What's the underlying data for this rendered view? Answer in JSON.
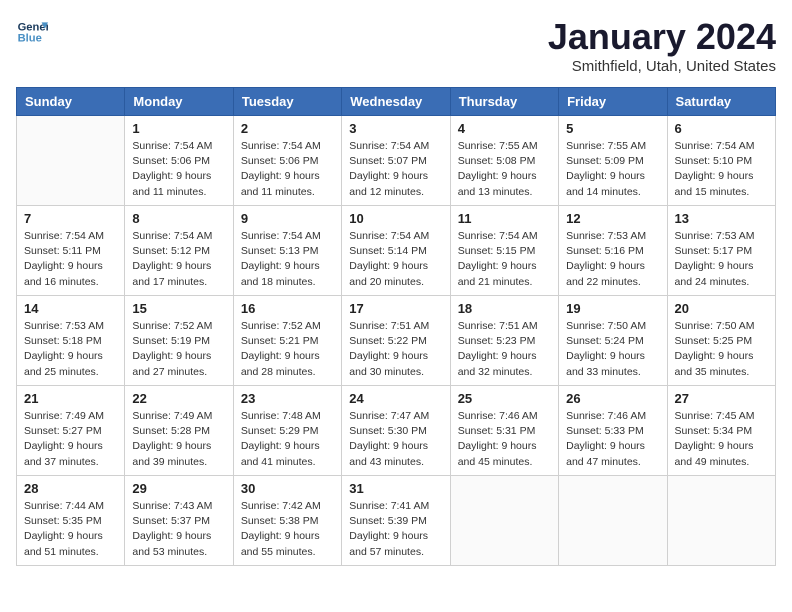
{
  "header": {
    "logo_line1": "General",
    "logo_line2": "Blue",
    "month_year": "January 2024",
    "location": "Smithfield, Utah, United States"
  },
  "weekdays": [
    "Sunday",
    "Monday",
    "Tuesday",
    "Wednesday",
    "Thursday",
    "Friday",
    "Saturday"
  ],
  "weeks": [
    [
      {
        "day": "",
        "info": ""
      },
      {
        "day": "1",
        "info": "Sunrise: 7:54 AM\nSunset: 5:06 PM\nDaylight: 9 hours\nand 11 minutes."
      },
      {
        "day": "2",
        "info": "Sunrise: 7:54 AM\nSunset: 5:06 PM\nDaylight: 9 hours\nand 11 minutes."
      },
      {
        "day": "3",
        "info": "Sunrise: 7:54 AM\nSunset: 5:07 PM\nDaylight: 9 hours\nand 12 minutes."
      },
      {
        "day": "4",
        "info": "Sunrise: 7:55 AM\nSunset: 5:08 PM\nDaylight: 9 hours\nand 13 minutes."
      },
      {
        "day": "5",
        "info": "Sunrise: 7:55 AM\nSunset: 5:09 PM\nDaylight: 9 hours\nand 14 minutes."
      },
      {
        "day": "6",
        "info": "Sunrise: 7:54 AM\nSunset: 5:10 PM\nDaylight: 9 hours\nand 15 minutes."
      }
    ],
    [
      {
        "day": "7",
        "info": "Sunrise: 7:54 AM\nSunset: 5:11 PM\nDaylight: 9 hours\nand 16 minutes."
      },
      {
        "day": "8",
        "info": "Sunrise: 7:54 AM\nSunset: 5:12 PM\nDaylight: 9 hours\nand 17 minutes."
      },
      {
        "day": "9",
        "info": "Sunrise: 7:54 AM\nSunset: 5:13 PM\nDaylight: 9 hours\nand 18 minutes."
      },
      {
        "day": "10",
        "info": "Sunrise: 7:54 AM\nSunset: 5:14 PM\nDaylight: 9 hours\nand 20 minutes."
      },
      {
        "day": "11",
        "info": "Sunrise: 7:54 AM\nSunset: 5:15 PM\nDaylight: 9 hours\nand 21 minutes."
      },
      {
        "day": "12",
        "info": "Sunrise: 7:53 AM\nSunset: 5:16 PM\nDaylight: 9 hours\nand 22 minutes."
      },
      {
        "day": "13",
        "info": "Sunrise: 7:53 AM\nSunset: 5:17 PM\nDaylight: 9 hours\nand 24 minutes."
      }
    ],
    [
      {
        "day": "14",
        "info": "Sunrise: 7:53 AM\nSunset: 5:18 PM\nDaylight: 9 hours\nand 25 minutes."
      },
      {
        "day": "15",
        "info": "Sunrise: 7:52 AM\nSunset: 5:19 PM\nDaylight: 9 hours\nand 27 minutes."
      },
      {
        "day": "16",
        "info": "Sunrise: 7:52 AM\nSunset: 5:21 PM\nDaylight: 9 hours\nand 28 minutes."
      },
      {
        "day": "17",
        "info": "Sunrise: 7:51 AM\nSunset: 5:22 PM\nDaylight: 9 hours\nand 30 minutes."
      },
      {
        "day": "18",
        "info": "Sunrise: 7:51 AM\nSunset: 5:23 PM\nDaylight: 9 hours\nand 32 minutes."
      },
      {
        "day": "19",
        "info": "Sunrise: 7:50 AM\nSunset: 5:24 PM\nDaylight: 9 hours\nand 33 minutes."
      },
      {
        "day": "20",
        "info": "Sunrise: 7:50 AM\nSunset: 5:25 PM\nDaylight: 9 hours\nand 35 minutes."
      }
    ],
    [
      {
        "day": "21",
        "info": "Sunrise: 7:49 AM\nSunset: 5:27 PM\nDaylight: 9 hours\nand 37 minutes."
      },
      {
        "day": "22",
        "info": "Sunrise: 7:49 AM\nSunset: 5:28 PM\nDaylight: 9 hours\nand 39 minutes."
      },
      {
        "day": "23",
        "info": "Sunrise: 7:48 AM\nSunset: 5:29 PM\nDaylight: 9 hours\nand 41 minutes."
      },
      {
        "day": "24",
        "info": "Sunrise: 7:47 AM\nSunset: 5:30 PM\nDaylight: 9 hours\nand 43 minutes."
      },
      {
        "day": "25",
        "info": "Sunrise: 7:46 AM\nSunset: 5:31 PM\nDaylight: 9 hours\nand 45 minutes."
      },
      {
        "day": "26",
        "info": "Sunrise: 7:46 AM\nSunset: 5:33 PM\nDaylight: 9 hours\nand 47 minutes."
      },
      {
        "day": "27",
        "info": "Sunrise: 7:45 AM\nSunset: 5:34 PM\nDaylight: 9 hours\nand 49 minutes."
      }
    ],
    [
      {
        "day": "28",
        "info": "Sunrise: 7:44 AM\nSunset: 5:35 PM\nDaylight: 9 hours\nand 51 minutes."
      },
      {
        "day": "29",
        "info": "Sunrise: 7:43 AM\nSunset: 5:37 PM\nDaylight: 9 hours\nand 53 minutes."
      },
      {
        "day": "30",
        "info": "Sunrise: 7:42 AM\nSunset: 5:38 PM\nDaylight: 9 hours\nand 55 minutes."
      },
      {
        "day": "31",
        "info": "Sunrise: 7:41 AM\nSunset: 5:39 PM\nDaylight: 9 hours\nand 57 minutes."
      },
      {
        "day": "",
        "info": ""
      },
      {
        "day": "",
        "info": ""
      },
      {
        "day": "",
        "info": ""
      }
    ]
  ]
}
